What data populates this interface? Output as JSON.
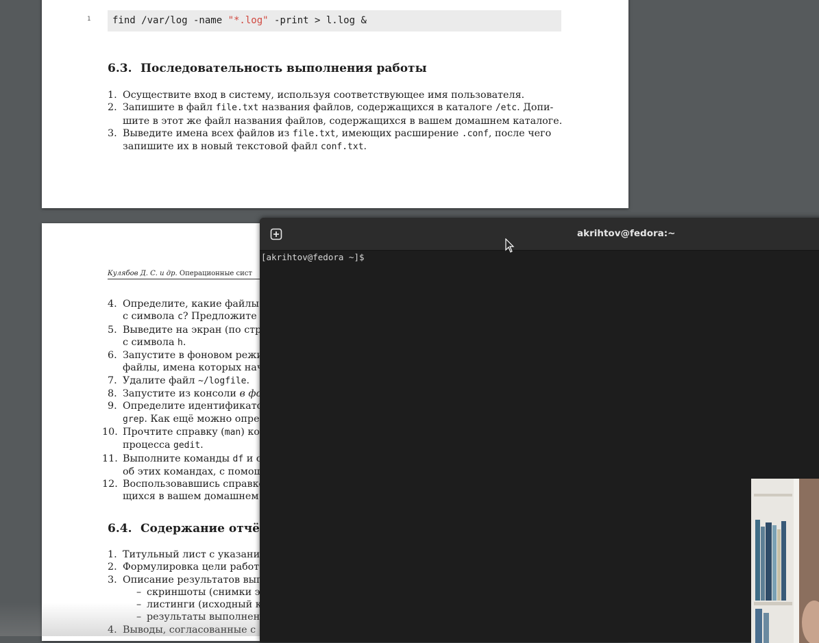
{
  "document": {
    "page1": {
      "code_line_number": "1",
      "code_prefix": "find /var/log -name ",
      "code_string": "\"*.log\"",
      "code_suffix": " -print > l.log &",
      "section_number": "6.3.",
      "section_title": "Последовательность выполнения работы",
      "steps": [
        {
          "n": "1.",
          "parts": [
            "Осуществите вход в систему, используя соответствующее имя пользователя."
          ]
        },
        {
          "n": "2.",
          "a": "Запишите в файл ",
          "c1": "file.txt",
          "b": " названия файлов, содержащихся в каталоге ",
          "c2": "/etc",
          "d": ". Допи-",
          "e": "шите в этот же файл названия файлов, содержащихся в вашем домашнем каталоге."
        },
        {
          "n": "3.",
          "a": "Выведите имена всех файлов из ",
          "c1": "file.txt",
          "b": ", имеющих расширение ",
          "c2": ".conf",
          "d": ", после чего",
          "e1": "запишите их в новый текстовой файл ",
          "c3": "conf.txt",
          "e2": "."
        }
      ]
    },
    "page2": {
      "running_head_italic": "Кулябов Д. С. и др.",
      "running_head_rest": " Операционные сист",
      "steps": [
        {
          "n": "4.",
          "l1": "Определите, какие файлы",
          "l2a": "с символа ",
          "l2c": "c",
          "l2b": "? Предложите"
        },
        {
          "n": "5.",
          "l1": "Выведите на экран (по стр",
          "l2a": "с символа ",
          "l2c": "h",
          "l2b": "."
        },
        {
          "n": "6.",
          "l1": "Запустите в фоновом режи",
          "l2": "файлы, имена которых нач"
        },
        {
          "n": "7.",
          "l1a": "Удалите файл ",
          "l1c": "~/logfile",
          "l1b": "."
        },
        {
          "n": "8.",
          "l1": "Запустите из консоли ",
          "l1i": "в фо"
        },
        {
          "n": "9.",
          "l1": "Определите идентификато",
          "l2c": "grep",
          "l2b": ". Как ещё можно опре"
        },
        {
          "n": "10.",
          "l1a": "Прочтите справку (",
          "l1c": "man",
          "l1b": ") ко",
          "l2a": "процесса ",
          "l2c": "gedit",
          "l2b": "."
        },
        {
          "n": "11.",
          "l1a": "Выполните команды ",
          "l1c": "df",
          "l1b": " и с",
          "l2": "об этих командах, с помощ"
        },
        {
          "n": "12.",
          "l1": "Воспользовавшись справко",
          "l2": "щихся в вашем домашнем"
        }
      ],
      "section_number": "6.4.",
      "section_title": "Содержание отчёта",
      "report_items": [
        {
          "n": "1.",
          "text": "Титульный лист с указани"
        },
        {
          "n": "2.",
          "text": "Формулировка цели работ"
        },
        {
          "n": "3.",
          "text": "Описание результатов вып"
        }
      ],
      "sub_items": [
        "скриншоты (снимки э",
        "листинги (исходный к",
        "результаты выполнен"
      ],
      "last_item": {
        "n": "4.",
        "text": "Выводы, согласованные с"
      }
    }
  },
  "terminal": {
    "title": "akrihtov@fedora:~",
    "prompt": "[akrihtov@fedora ~]$",
    "new_tab_icon": "plus-square-icon"
  }
}
